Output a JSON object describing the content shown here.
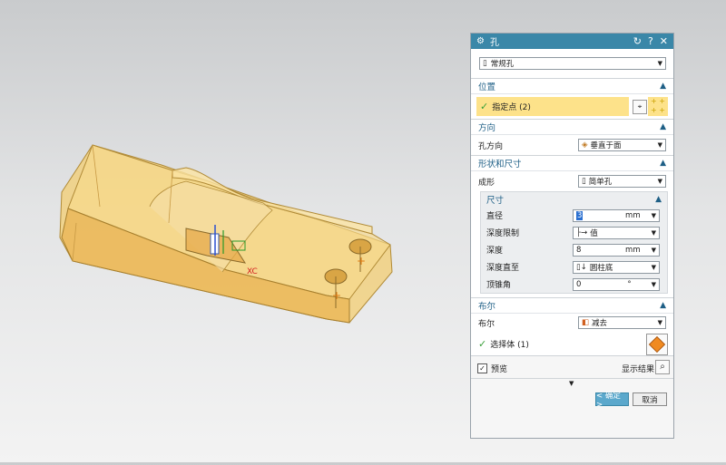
{
  "viewport": {
    "axis_label": "XC",
    "colors": {
      "body": "#f0c466",
      "edge": "#b08a36"
    }
  },
  "dialog": {
    "title": "孔",
    "type_select": "常规孔",
    "position": {
      "header": "位置",
      "specify_point": "指定点 (2)"
    },
    "direction": {
      "header": "方向",
      "label": "孔方向",
      "value": "垂直于面"
    },
    "shape": {
      "header": "形状和尺寸",
      "form_label": "成形",
      "form_value": "简单孔",
      "dimensions": {
        "header": "尺寸",
        "rows": [
          {
            "label": "直径",
            "value": "3",
            "unit": "mm"
          },
          {
            "label": "深度限制",
            "value": "值",
            "unit": ""
          },
          {
            "label": "深度",
            "value": "8",
            "unit": "mm"
          },
          {
            "label": "深度直至",
            "value": "圆柱底",
            "unit": ""
          },
          {
            "label": "顶锥角",
            "value": "0",
            "unit": "°"
          }
        ]
      }
    },
    "boolean": {
      "header": "布尔",
      "label": "布尔",
      "value": "减去",
      "select_body": "选择体 (1)"
    },
    "preview_label": "预览",
    "show_result_label": "显示结果",
    "ok_label": "< 确定 >",
    "cancel_label": "取消",
    "colors": {
      "title": "#3a87a8",
      "highlight": "#fde28a",
      "accent": "#1e5f86",
      "check": "#3aa03a",
      "ok_bg": "#5ba8cc"
    }
  }
}
